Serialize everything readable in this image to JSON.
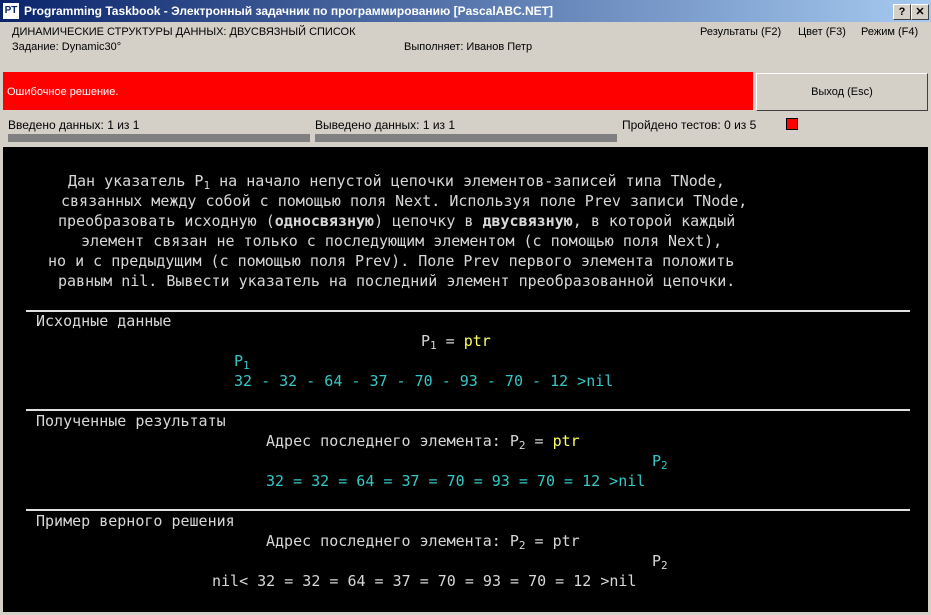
{
  "window": {
    "title": "Programming Taskbook - Электронный задачник по программированию [PascalABC.NET]",
    "app_icon": "PT",
    "help_button": "?",
    "close_button": "✕"
  },
  "header": {
    "topic": "ДИНАМИЧЕСКИЕ СТРУКТУРЫ ДАННЫХ: ДВУСВЯЗНЫЙ СПИСОК",
    "task": "Задание: Dynamic30°",
    "student": "Выполняет: Иванов Петр",
    "menu": {
      "results": "Результаты (F2)",
      "color": "Цвет (F3)",
      "mode": "Режим (F4)"
    }
  },
  "status": {
    "message": "Ошибочное решение.",
    "exit_button": "Выход (Esc)",
    "input_label": "Введено данных: 1 из 1",
    "output_label": "Выведено данных: 1 из 1",
    "tests_label": "Пройдено тестов: 0 из 5",
    "input_progress": 1.0,
    "output_progress": 1.0
  },
  "task_text": {
    "l1_a": "Дан указатель P",
    "l1_sub": "1",
    "l1_b": " на начало непустой цепочки элементов-записей типа TNode,",
    "l2": "связанных между собой с помощью поля Next. Используя поле Prev записи TNode,",
    "l3_a": "преобразовать исходную (",
    "l3_bold1": "односвязную",
    "l3_b": ") цепочку в ",
    "l3_bold2": "двусвязную",
    "l3_c": ", в которой каждый",
    "l4": "элемент связан не только с последующим элементом (с помощью поля Next),",
    "l5": "но и с предыдущим (с помощью поля Prev). Поле Prev первого элемента положить",
    "l6": "равным nil. Вывести указатель на последний элемент преобразованной цепочки."
  },
  "source_section": {
    "title": "Исходные данные",
    "ptr_label": "P",
    "ptr_sub": "1",
    "ptr_eq": " = ",
    "ptr_val": "ptr",
    "marker": "P",
    "marker_sub": "1",
    "chain": "32 - 32 - 64 - 37 - 70 - 93 - 70 - 12 >nil"
  },
  "result_section": {
    "title": "Полученные результаты",
    "addr_label": "Адрес последнего элемента: P",
    "addr_sub": "2",
    "addr_eq": " = ",
    "addr_val": "ptr",
    "marker": "P",
    "marker_sub": "2",
    "chain": "32 = 32 = 64 = 37 = 70 = 93 = 70 = 12 >nil"
  },
  "example_section": {
    "title": "Пример верного решения",
    "addr_label": "Адрес последнего элемента: P",
    "addr_sub": "2",
    "addr_eq": " = ptr",
    "marker": "P",
    "marker_sub": "2",
    "chain": "nil< 32 = 32 = 64 = 37 = 70 = 93 = 70 = 12 >nil"
  },
  "colors": {
    "error_panel": "#ff0000",
    "console_bg": "#000000",
    "value_cyan": "#36c8c8",
    "ptr_yellow": "#ffff60"
  }
}
